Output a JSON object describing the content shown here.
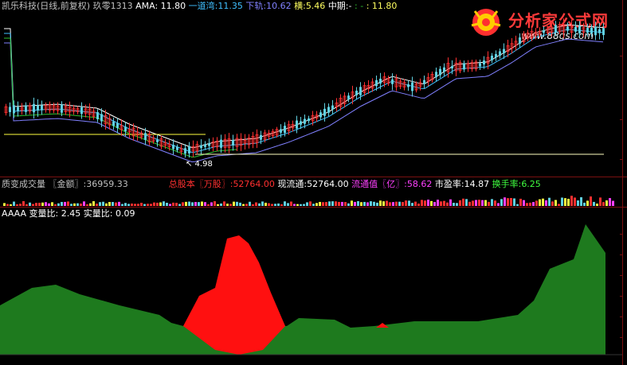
{
  "header": {
    "stock_name": "凯乐科技(日线,前复权)",
    "indicator_name": "玖零1313",
    "ama_label": "AMA:",
    "ama_value": "11.80",
    "line1_label": "一道湾:",
    "line1_value": "11.35",
    "lower_label": "下轨:",
    "lower_value": "10.62",
    "horiz_label": "横:",
    "horiz_value": "5.46",
    "mid_label": "中期:",
    "mid_value": "-",
    "mid_extra": ": -",
    "mid_last": ": 11.80"
  },
  "volume_header": {
    "title": "质变成交量",
    "amount_label": "〖金额〗:",
    "amount_value": "36959.33",
    "total_shares_label": "总股本〖万股〗:",
    "total_shares_value": "52764.00",
    "float_label": "现流通:",
    "float_value": "52764.00",
    "float_value_label": "流通值〖亿〗:",
    "float_value_value": "58.62",
    "pe_label": "市盈率:",
    "pe_value": "14.87",
    "turnover_label": "换手率:",
    "turnover_value": "6.25"
  },
  "indicator_header": {
    "name": "AAAA",
    "var_label": "变量比:",
    "var_value": "2.45",
    "real_label": "实量比:",
    "real_value": "0.09"
  },
  "annotation": {
    "low_price": "4.98"
  },
  "logo": {
    "title": "分析家公式网",
    "url": "www.88gs.com"
  },
  "colors": {
    "background": "#000000",
    "separator": "#7a1010",
    "up": "#ff3030",
    "down": "#60d0e0",
    "green_area": "#1e7a1e",
    "red_area": "#ff1010",
    "yellow": "#ffff40",
    "magenta": "#ff40ff",
    "white": "#ffffff"
  }
}
